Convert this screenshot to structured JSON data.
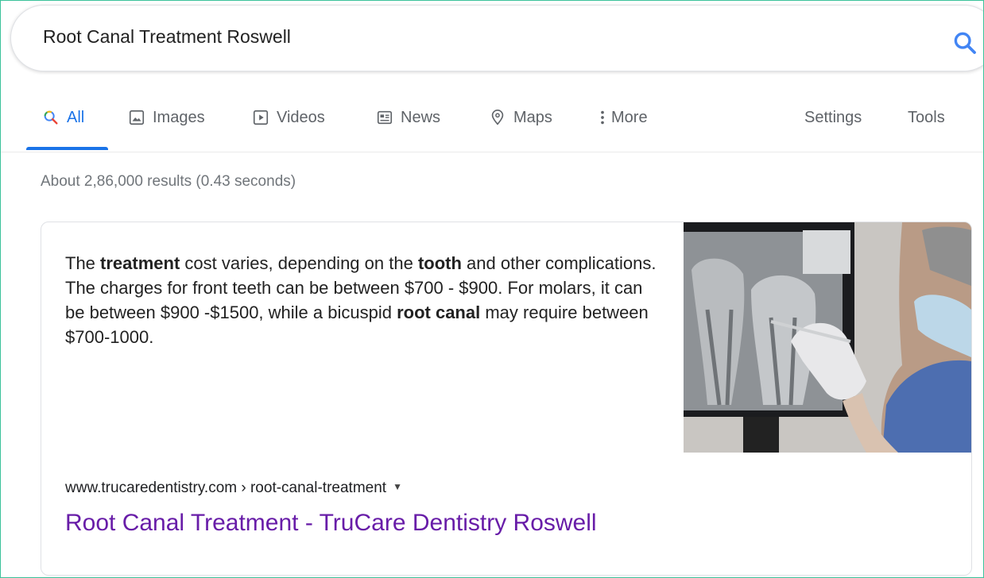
{
  "search": {
    "query": "Root Canal Treatment Roswell"
  },
  "tabs": [
    {
      "label": "All",
      "icon": "search-icon",
      "active": true
    },
    {
      "label": "Images",
      "icon": "image-icon",
      "active": false
    },
    {
      "label": "Videos",
      "icon": "play-icon",
      "active": false
    },
    {
      "label": "News",
      "icon": "newspaper-icon",
      "active": false
    },
    {
      "label": "Maps",
      "icon": "map-pin-icon",
      "active": false
    },
    {
      "label": "More",
      "icon": "more-vertical-icon",
      "active": false
    }
  ],
  "tools": {
    "settings_label": "Settings",
    "tools_label": "Tools"
  },
  "stats": "About 2,86,000 results (0.43 seconds)",
  "featured_snippet": {
    "segments": [
      {
        "text": "The ",
        "bold": false
      },
      {
        "text": "treatment",
        "bold": true
      },
      {
        "text": " cost varies, depending on the ",
        "bold": false
      },
      {
        "text": "tooth",
        "bold": true
      },
      {
        "text": " and other complications. The charges for front teeth can be between $700 - $900. For molars, it can be between $900 -$1500, while a bicuspid ",
        "bold": false
      },
      {
        "text": "root canal",
        "bold": true
      },
      {
        "text": " may require between $700-1000.",
        "bold": false
      }
    ],
    "cite": "www.trucaredentistry.com › root-canal-treatment",
    "link_title": "Root Canal Treatment - TruCare Dentistry Roswell"
  },
  "colors": {
    "accent_blue": "#1a73e8",
    "visited_link": "#681da8",
    "frame_border": "#3cc29a"
  }
}
